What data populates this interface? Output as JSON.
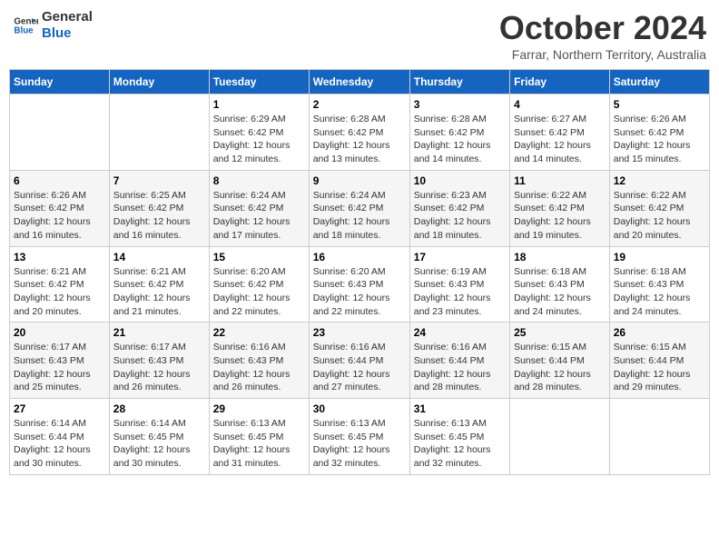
{
  "header": {
    "logo_line1": "General",
    "logo_line2": "Blue",
    "month_title": "October 2024",
    "subtitle": "Farrar, Northern Territory, Australia"
  },
  "weekdays": [
    "Sunday",
    "Monday",
    "Tuesday",
    "Wednesday",
    "Thursday",
    "Friday",
    "Saturday"
  ],
  "weeks": [
    [
      {
        "day": "",
        "info": ""
      },
      {
        "day": "",
        "info": ""
      },
      {
        "day": "1",
        "info": "Sunrise: 6:29 AM\nSunset: 6:42 PM\nDaylight: 12 hours and 12 minutes."
      },
      {
        "day": "2",
        "info": "Sunrise: 6:28 AM\nSunset: 6:42 PM\nDaylight: 12 hours and 13 minutes."
      },
      {
        "day": "3",
        "info": "Sunrise: 6:28 AM\nSunset: 6:42 PM\nDaylight: 12 hours and 14 minutes."
      },
      {
        "day": "4",
        "info": "Sunrise: 6:27 AM\nSunset: 6:42 PM\nDaylight: 12 hours and 14 minutes."
      },
      {
        "day": "5",
        "info": "Sunrise: 6:26 AM\nSunset: 6:42 PM\nDaylight: 12 hours and 15 minutes."
      }
    ],
    [
      {
        "day": "6",
        "info": "Sunrise: 6:26 AM\nSunset: 6:42 PM\nDaylight: 12 hours and 16 minutes."
      },
      {
        "day": "7",
        "info": "Sunrise: 6:25 AM\nSunset: 6:42 PM\nDaylight: 12 hours and 16 minutes."
      },
      {
        "day": "8",
        "info": "Sunrise: 6:24 AM\nSunset: 6:42 PM\nDaylight: 12 hours and 17 minutes."
      },
      {
        "day": "9",
        "info": "Sunrise: 6:24 AM\nSunset: 6:42 PM\nDaylight: 12 hours and 18 minutes."
      },
      {
        "day": "10",
        "info": "Sunrise: 6:23 AM\nSunset: 6:42 PM\nDaylight: 12 hours and 18 minutes."
      },
      {
        "day": "11",
        "info": "Sunrise: 6:22 AM\nSunset: 6:42 PM\nDaylight: 12 hours and 19 minutes."
      },
      {
        "day": "12",
        "info": "Sunrise: 6:22 AM\nSunset: 6:42 PM\nDaylight: 12 hours and 20 minutes."
      }
    ],
    [
      {
        "day": "13",
        "info": "Sunrise: 6:21 AM\nSunset: 6:42 PM\nDaylight: 12 hours and 20 minutes."
      },
      {
        "day": "14",
        "info": "Sunrise: 6:21 AM\nSunset: 6:42 PM\nDaylight: 12 hours and 21 minutes."
      },
      {
        "day": "15",
        "info": "Sunrise: 6:20 AM\nSunset: 6:42 PM\nDaylight: 12 hours and 22 minutes."
      },
      {
        "day": "16",
        "info": "Sunrise: 6:20 AM\nSunset: 6:43 PM\nDaylight: 12 hours and 22 minutes."
      },
      {
        "day": "17",
        "info": "Sunrise: 6:19 AM\nSunset: 6:43 PM\nDaylight: 12 hours and 23 minutes."
      },
      {
        "day": "18",
        "info": "Sunrise: 6:18 AM\nSunset: 6:43 PM\nDaylight: 12 hours and 24 minutes."
      },
      {
        "day": "19",
        "info": "Sunrise: 6:18 AM\nSunset: 6:43 PM\nDaylight: 12 hours and 24 minutes."
      }
    ],
    [
      {
        "day": "20",
        "info": "Sunrise: 6:17 AM\nSunset: 6:43 PM\nDaylight: 12 hours and 25 minutes."
      },
      {
        "day": "21",
        "info": "Sunrise: 6:17 AM\nSunset: 6:43 PM\nDaylight: 12 hours and 26 minutes."
      },
      {
        "day": "22",
        "info": "Sunrise: 6:16 AM\nSunset: 6:43 PM\nDaylight: 12 hours and 26 minutes."
      },
      {
        "day": "23",
        "info": "Sunrise: 6:16 AM\nSunset: 6:44 PM\nDaylight: 12 hours and 27 minutes."
      },
      {
        "day": "24",
        "info": "Sunrise: 6:16 AM\nSunset: 6:44 PM\nDaylight: 12 hours and 28 minutes."
      },
      {
        "day": "25",
        "info": "Sunrise: 6:15 AM\nSunset: 6:44 PM\nDaylight: 12 hours and 28 minutes."
      },
      {
        "day": "26",
        "info": "Sunrise: 6:15 AM\nSunset: 6:44 PM\nDaylight: 12 hours and 29 minutes."
      }
    ],
    [
      {
        "day": "27",
        "info": "Sunrise: 6:14 AM\nSunset: 6:44 PM\nDaylight: 12 hours and 30 minutes."
      },
      {
        "day": "28",
        "info": "Sunrise: 6:14 AM\nSunset: 6:45 PM\nDaylight: 12 hours and 30 minutes."
      },
      {
        "day": "29",
        "info": "Sunrise: 6:13 AM\nSunset: 6:45 PM\nDaylight: 12 hours and 31 minutes."
      },
      {
        "day": "30",
        "info": "Sunrise: 6:13 AM\nSunset: 6:45 PM\nDaylight: 12 hours and 32 minutes."
      },
      {
        "day": "31",
        "info": "Sunrise: 6:13 AM\nSunset: 6:45 PM\nDaylight: 12 hours and 32 minutes."
      },
      {
        "day": "",
        "info": ""
      },
      {
        "day": "",
        "info": ""
      }
    ]
  ]
}
